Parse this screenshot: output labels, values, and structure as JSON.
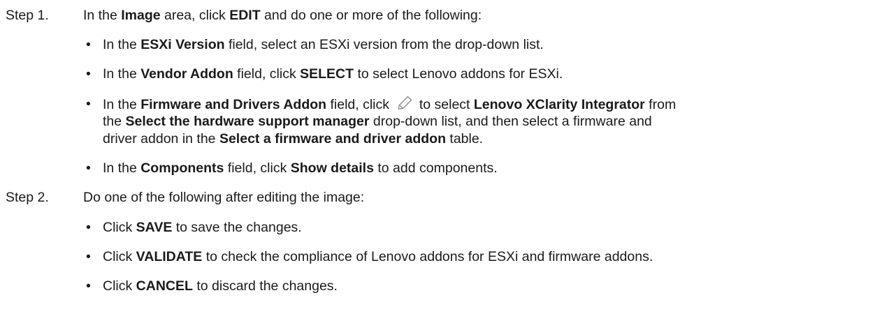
{
  "step1": {
    "label": "Step 1.",
    "text": {
      "a": "In the ",
      "b": "Image",
      "c": " area, click ",
      "d": "EDIT",
      "e": " and do one or more of the following:"
    },
    "bullets": [
      {
        "a": "In the ",
        "b": "ESXi Version",
        "c": " field, select an ESXi version from the drop-down list."
      },
      {
        "a": "In the ",
        "b": "Vendor Addon",
        "c": " field, click ",
        "d": "SELECT",
        "e": " to select Lenovo addons for ESXi."
      },
      {
        "line1": {
          "a": "In the ",
          "b": "Firmware and Drivers Addon",
          "c": " field, click ",
          "icon": "pencil-icon",
          "d": " to select ",
          "e": "Lenovo XClarity Integrator",
          "f": " from"
        },
        "line2": {
          "a": "the ",
          "b": "Select the hardware support manager",
          "c": " drop-down list, and then select a firmware and"
        },
        "line3": {
          "a": "driver addon in the ",
          "b": "Select a firmware and driver addon",
          "c": " table."
        }
      },
      {
        "a": "In the ",
        "b": "Components",
        "c": " field, click ",
        "d": "Show details",
        "e": " to add components."
      }
    ]
  },
  "step2": {
    "label": "Step 2.",
    "text": "Do one of the following after editing the image:",
    "bullets": [
      {
        "a": "Click ",
        "b": "SAVE",
        "c": " to save the changes."
      },
      {
        "a": "Click ",
        "b": "VALIDATE",
        "c": " to check the compliance of Lenovo addons for ESXi and firmware addons."
      },
      {
        "a": "Click ",
        "b": "CANCEL",
        "c": " to discard the changes."
      }
    ]
  },
  "bullet_glyph": "•"
}
